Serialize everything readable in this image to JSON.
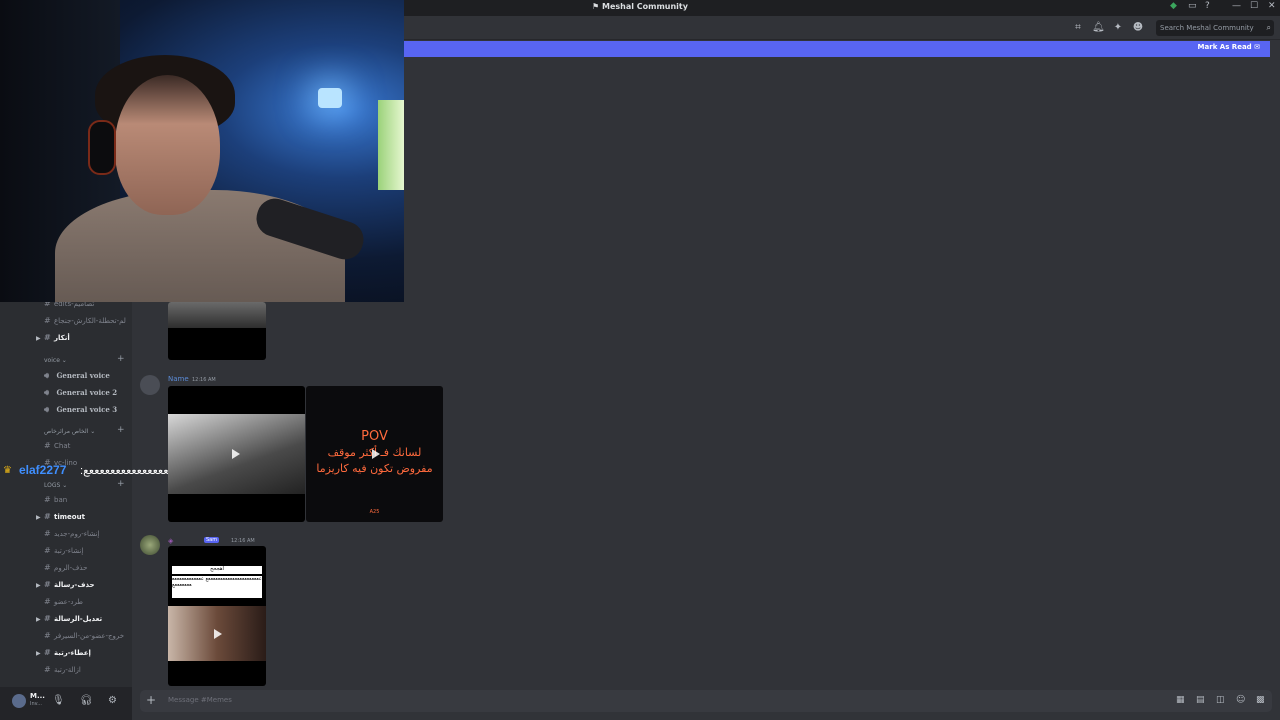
{
  "window": {
    "title": "Meshal Community",
    "controls": [
      "—",
      "☐",
      "✕"
    ]
  },
  "header": {
    "search_placeholder": "Search Meshal Community"
  },
  "banner": {
    "mark_as_read": "Mark As Read"
  },
  "sidebar": {
    "top_channels": [
      {
        "label": "edits-تصاميم",
        "bold": false
      },
      {
        "label": "لم-تحطلة-الكارش-جنجاع",
        "bold": false
      },
      {
        "label": "أنكار",
        "bold": true
      }
    ],
    "voice_category": "voice",
    "voice_channels": [
      "General voice",
      "General voice 2",
      "General voice 3"
    ],
    "private_category": "الخاص مرائرخاص",
    "private_channels": [
      "Chat",
      "vc-lino"
    ],
    "logs_category": "LOGS",
    "log_channels": [
      {
        "label": "ban",
        "bold": false
      },
      {
        "label": "timeout",
        "bold": true
      },
      {
        "label": "إنشاء-روم-جديد",
        "bold": false
      },
      {
        "label": "إنشاء-رتبة",
        "bold": false
      },
      {
        "label": "حذف-الروم",
        "bold": false
      },
      {
        "label": "حذف-رسالة",
        "bold": true
      },
      {
        "label": "طرد-عضو",
        "bold": false
      },
      {
        "label": "تعديل-الرسالة",
        "bold": true
      },
      {
        "label": "خروج-عضو-من-السيرفر",
        "bold": false
      },
      {
        "label": "إعطاء-رتبة",
        "bold": true
      },
      {
        "label": "ازالة-رتبة",
        "bold": false
      }
    ]
  },
  "user_panel": {
    "name": "M...",
    "status": "Inv..."
  },
  "messages": [
    {
      "author": "Name",
      "time": "12:16 AM",
      "author_color": "#5b8bd6"
    },
    {
      "author": "",
      "badge": "Sam",
      "time": "12:16 AM",
      "author_color": "#9b59b6"
    }
  ],
  "pov_video": {
    "pov": "POV",
    "line1": "لسانك فـ أكثر موقف",
    "line2": "مفروض تكون فيه كاريزما",
    "tag": "A25"
  },
  "meme_image": {
    "caption": "اهجحح",
    "text": "ععععععععععععععععععععععع ععععععععععععععععععععع"
  },
  "composer": {
    "placeholder": "Message #Memes"
  },
  "stream_overlay": {
    "username": "elaf2277",
    "text": ":ععععععععععععععععععععععععععععع"
  },
  "colors": {
    "accent": "#5865f2",
    "bg": "#313338",
    "sidebar": "#2b2d31"
  }
}
